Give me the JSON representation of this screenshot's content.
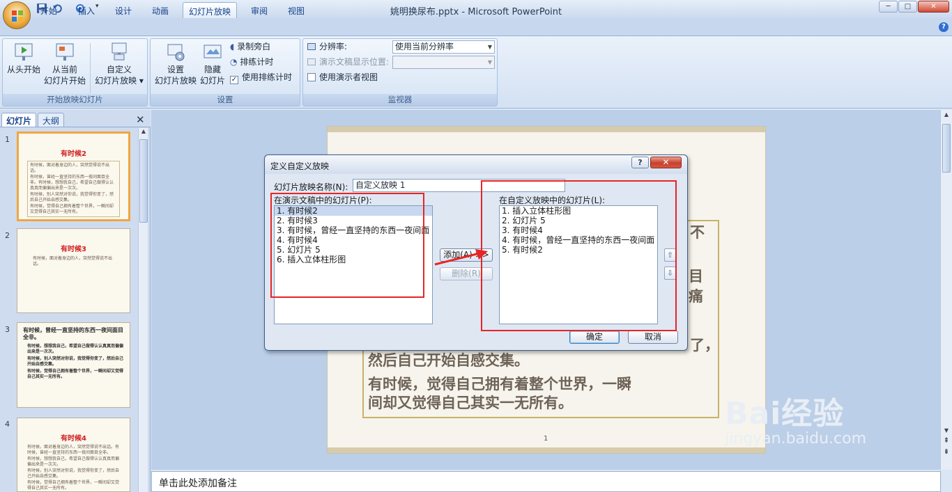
{
  "app": {
    "title": "姚明换尿布.pptx - Microsoft PowerPoint"
  },
  "window_controls": {
    "minimize": "─",
    "maximize": "□",
    "close": "✕"
  },
  "tabs": [
    {
      "label": "开始"
    },
    {
      "label": "插入"
    },
    {
      "label": "设计"
    },
    {
      "label": "动画"
    },
    {
      "label": "幻灯片放映",
      "active": true
    },
    {
      "label": "审阅"
    },
    {
      "label": "视图"
    }
  ],
  "ribbon": {
    "group_start": {
      "label": "开始放映幻灯片",
      "from_beginning": [
        "从头开始"
      ],
      "from_current": [
        "从当前",
        "幻灯片开始"
      ],
      "custom_show": [
        "自定义",
        "幻灯片放映 ▾"
      ]
    },
    "group_setup": {
      "label": "设置",
      "setup_show": [
        "设置",
        "幻灯片放映"
      ],
      "hide_slide": [
        "隐藏",
        "幻灯片"
      ],
      "record_narration": "录制旁白",
      "rehearse_timings": "排练计时",
      "use_rehearsed": "使用排练计时"
    },
    "group_monitor": {
      "label": "监视器",
      "resolution_label": "分辨率:",
      "resolution_value": "使用当前分辨率",
      "show_on_label": "演示文稿显示位置:",
      "presenter_view": "使用演示者视图"
    }
  },
  "left_pane": {
    "tab_slides": "幻灯片",
    "tab_outline": "大纲",
    "close": "✕",
    "thumbnails": [
      {
        "num": "1",
        "title": "有时候2",
        "lines": [
          "有时候，面对着身边的人，突然觉得说不出话。",
          "有时候，曾经一直坚持的东西一夜间面目全非。有时候，想想我自己，希望自己做得认认真真而偏偏出来是一次次。",
          "有时候，别人突然对你说，我觉得你变了，然后自己开始自感交集。",
          "有时候，觉得自己拥有着整个世界，一瞬间却又觉得自己其实一无所有。"
        ]
      },
      {
        "num": "2",
        "title": "有时候3",
        "lines": [
          "有时候，面对着身边的人，突然觉得说不出话。"
        ]
      },
      {
        "num": "3",
        "title": "有时候，曾经一直坚持的东西一夜间面目全非。",
        "lines": [
          "有时候，想想我自己，希望自己做得认认真真而偏偏出来是一次次。",
          "有时候，别人突然对你说，我觉得你变了，然后自己开始自感交集。",
          "有时候，觉得自己拥有着整个世界，一瞬间却又觉得自己其实一无所有。"
        ]
      },
      {
        "num": "4",
        "title": "有时候4",
        "lines": [
          "有时候，面对着身边的人，突然觉得说不出话。有时候，曾经一直坚持的东西一夜间面目全非。",
          "有时候，想想我自己，希望自己做得认认真真而偏偏出来是一次次。",
          "有时候，别人突然对你说，我觉得你变了，然后自己开始自感交集。",
          "有时候，觉得自己拥有着整个世界，一瞬间却又觉得自己其实一无所有。"
        ]
      }
    ]
  },
  "slide": {
    "visible_fragments": [
      "不",
      "目",
      "痛",
      "了，"
    ],
    "lines": [
      "然后自己开始自感交集。",
      "有时候，觉得自己拥有着整个世界，一瞬",
      "间却又觉得自己其实一无所有。"
    ],
    "page_number": "1"
  },
  "notes": {
    "placeholder": "单击此处添加备注"
  },
  "dialog": {
    "title": "定义自定义放映",
    "help": "?",
    "close": "✕",
    "name_label": "幻灯片放映名称(N):",
    "name_value": "自定义放映 1",
    "left_label": "在演示文稿中的幻灯片(P):",
    "left_items": [
      "1.  有时候2",
      "2.  有时候3",
      "3.  有时候，曾经一直坚持的东西一夜间面",
      "4.  有时候4",
      "5.  幻灯片 5",
      "6.  插入立体柱形图"
    ],
    "right_label": "在自定义放映中的幻灯片(L):",
    "right_items": [
      "1.  插入立体柱形图",
      "2.  幻灯片 5",
      "3.  有时候4",
      "4.  有时候，曾经一直坚持的东西一夜间面",
      "5.  有时候2"
    ],
    "add_button": "添加(A) >>",
    "remove_button": "删除(R)",
    "ok_button": "确定",
    "cancel_button": "取消",
    "move_up": "⇧",
    "move_down": "⇩"
  },
  "watermark": {
    "brand": "Bai经验",
    "url": "jingyan.baidu.com"
  },
  "colors": {
    "annotation_red": "#e82424",
    "title_red": "#d02020",
    "ribbon_blue": "#15428b"
  }
}
